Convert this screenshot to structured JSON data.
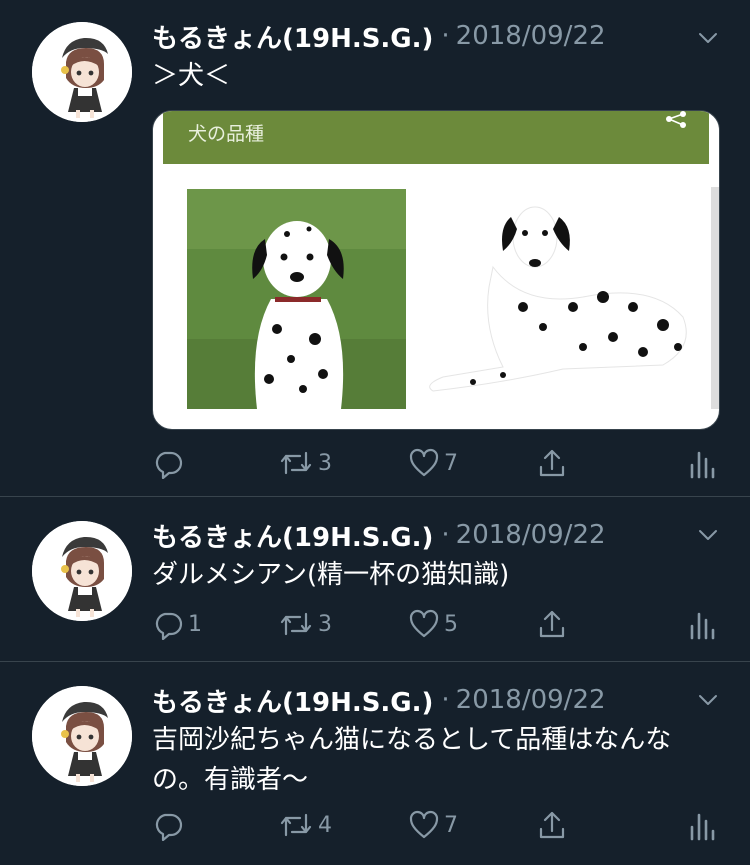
{
  "tweets": [
    {
      "name": "もるきょん(19H.S.G.)",
      "separator": "·",
      "date": "2018/09/22",
      "text": "＞犬＜",
      "media": {
        "header_label": "犬の品種"
      },
      "actions": {
        "reply": "",
        "retweets": "3",
        "likes": "7"
      }
    },
    {
      "name": "もるきょん(19H.S.G.)",
      "separator": "·",
      "date": "2018/09/22",
      "text": "ダルメシアン(精一杯の猫知識)",
      "actions": {
        "reply": "1",
        "retweets": "3",
        "likes": "5"
      }
    },
    {
      "name": "もるきょん(19H.S.G.)",
      "separator": "·",
      "date": "2018/09/22",
      "text": "吉岡沙紀ちゃん猫になるとして品種はなんなの。有識者〜",
      "actions": {
        "reply": "",
        "retweets": "4",
        "likes": "7"
      }
    }
  ],
  "colors": {
    "background": "#15202b",
    "muted": "#8899a6",
    "divider": "#38444d",
    "media_header": "#6c8a3b"
  }
}
